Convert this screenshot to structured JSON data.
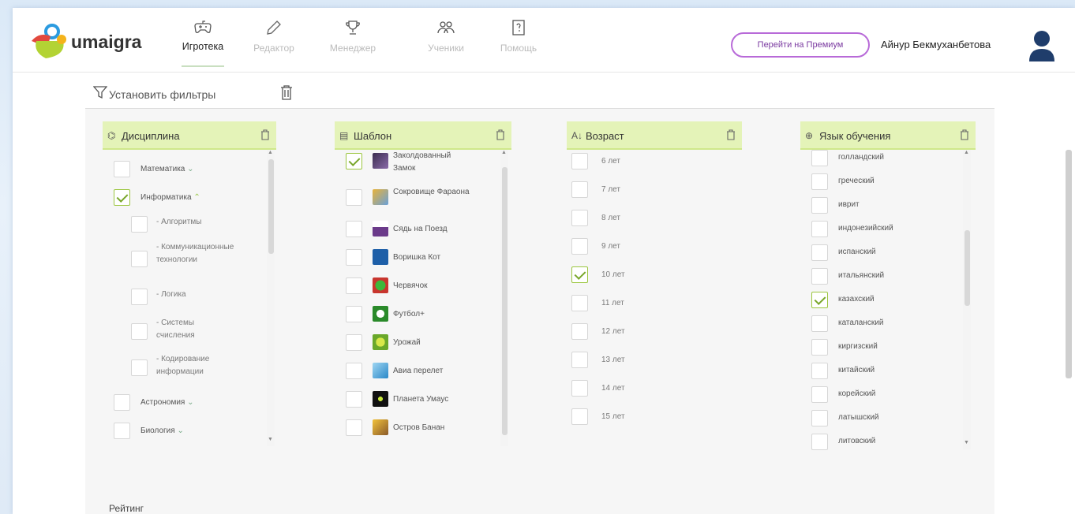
{
  "app": {
    "brand": "umaigra"
  },
  "nav": {
    "items": [
      {
        "label": "Игротека",
        "icon": "gamepad-icon",
        "active": true
      },
      {
        "label": "Редактор",
        "icon": "pencil-icon",
        "active": false
      },
      {
        "label": "Менеджер",
        "icon": "trophy-icon",
        "active": false
      },
      {
        "label": "Ученики",
        "icon": "users-icon",
        "active": false
      },
      {
        "label": "Помощь",
        "icon": "help-icon",
        "active": false
      }
    ]
  },
  "header": {
    "premium_label": "Перейти на Премиум",
    "user_name": "Айнур Бекмуханбетова"
  },
  "filters": {
    "label": "Установить фильтры"
  },
  "discipline": {
    "title": "Дисциплина",
    "items": [
      {
        "label": "Математика",
        "checked": false,
        "expand": "down"
      },
      {
        "label": "Информатика",
        "checked": true,
        "expand": "up"
      },
      {
        "label": "- Алгоритмы",
        "checked": false
      },
      {
        "label": "- Коммуникационные технологии",
        "checked": false
      },
      {
        "label": "- Логика",
        "checked": false
      },
      {
        "label": "- Системы счисления",
        "checked": false
      },
      {
        "label": "- Кодирование информации",
        "checked": false
      },
      {
        "label": "Астрономия",
        "checked": false,
        "expand": "down"
      },
      {
        "label": "Биология",
        "checked": false,
        "expand": "down"
      }
    ]
  },
  "template": {
    "title": "Шаблон",
    "items": [
      {
        "label": "Заколдованный Замок",
        "checked": true
      },
      {
        "label": "Сокровище Фараона",
        "checked": false
      },
      {
        "label": "Сядь на Поезд",
        "checked": false
      },
      {
        "label": "Воришка Кот",
        "checked": false
      },
      {
        "label": "Червячок",
        "checked": false
      },
      {
        "label": "Футбол+",
        "checked": false
      },
      {
        "label": "Урожай",
        "checked": false
      },
      {
        "label": "Авиа перелет",
        "checked": false
      },
      {
        "label": "Планета Умаус",
        "checked": false
      },
      {
        "label": "Остров Банан",
        "checked": false
      }
    ]
  },
  "age": {
    "title": "Возраст",
    "items": [
      {
        "label": "6 лет",
        "checked": false
      },
      {
        "label": "7 лет",
        "checked": false
      },
      {
        "label": "8 лет",
        "checked": false
      },
      {
        "label": "9 лет",
        "checked": false
      },
      {
        "label": "10 лет",
        "checked": true
      },
      {
        "label": "11 лет",
        "checked": false
      },
      {
        "label": "12 лет",
        "checked": false
      },
      {
        "label": "13 лет",
        "checked": false
      },
      {
        "label": "14 лет",
        "checked": false
      },
      {
        "label": "15 лет",
        "checked": false
      }
    ]
  },
  "language": {
    "title": "Язык обучения",
    "items": [
      {
        "label": "голландский",
        "checked": false
      },
      {
        "label": "греческий",
        "checked": false
      },
      {
        "label": "иврит",
        "checked": false
      },
      {
        "label": "индонезийский",
        "checked": false
      },
      {
        "label": "испанский",
        "checked": false
      },
      {
        "label": "итальянский",
        "checked": false
      },
      {
        "label": "казахский",
        "checked": true
      },
      {
        "label": "каталанский",
        "checked": false
      },
      {
        "label": "киргизский",
        "checked": false
      },
      {
        "label": "китайский",
        "checked": false
      },
      {
        "label": "корейский",
        "checked": false
      },
      {
        "label": "латышский",
        "checked": false
      },
      {
        "label": "литовский",
        "checked": false
      }
    ]
  },
  "rating": {
    "label": "Рейтинг"
  }
}
